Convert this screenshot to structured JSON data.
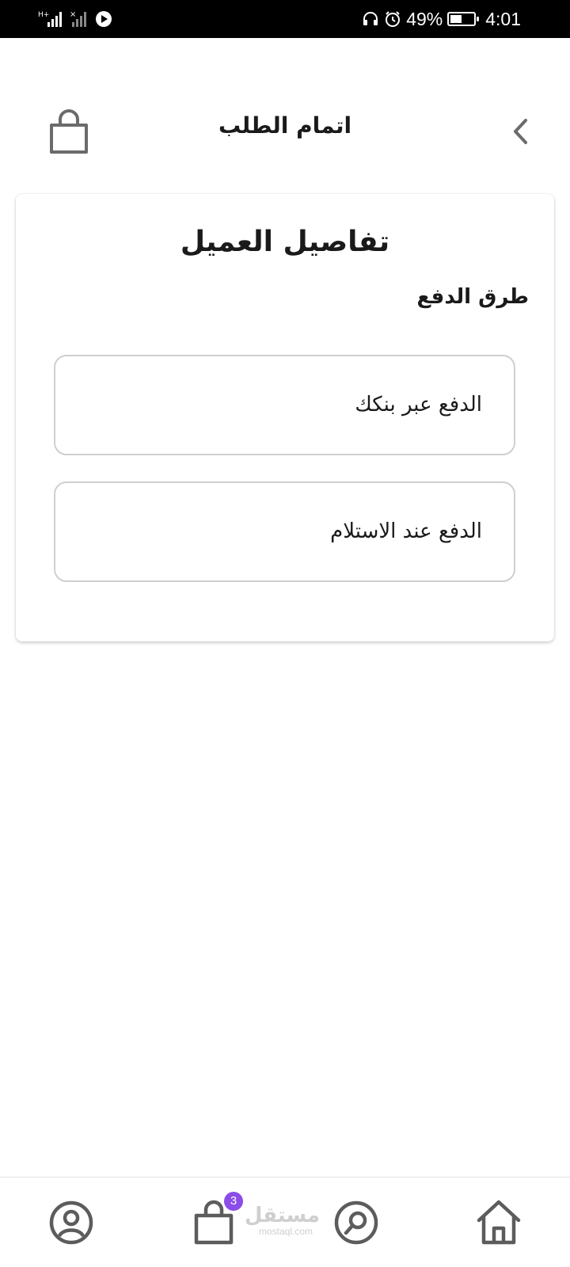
{
  "status_bar": {
    "battery_text": "49%",
    "battery_level": 0.49,
    "time": "4:01"
  },
  "header": {
    "title": "اتمام الطلب",
    "left_icon": "shopping-bag-icon",
    "right_icon": "chevron-left-icon"
  },
  "card": {
    "title": "تفاصيل العميل",
    "section_label": "طرق الدفع",
    "payment_options": [
      {
        "label": "الدفع عبر بنكك"
      },
      {
        "label": "الدفع عند الاستلام"
      }
    ]
  },
  "bottom_nav": {
    "items": [
      "profile-icon",
      "shopping-bag-icon",
      "search-icon",
      "home-icon"
    ],
    "cart_badge": "3",
    "badge_color": "#8b4de8",
    "watermark": {
      "ar": "مستقل",
      "en": "mostaql.com"
    }
  }
}
